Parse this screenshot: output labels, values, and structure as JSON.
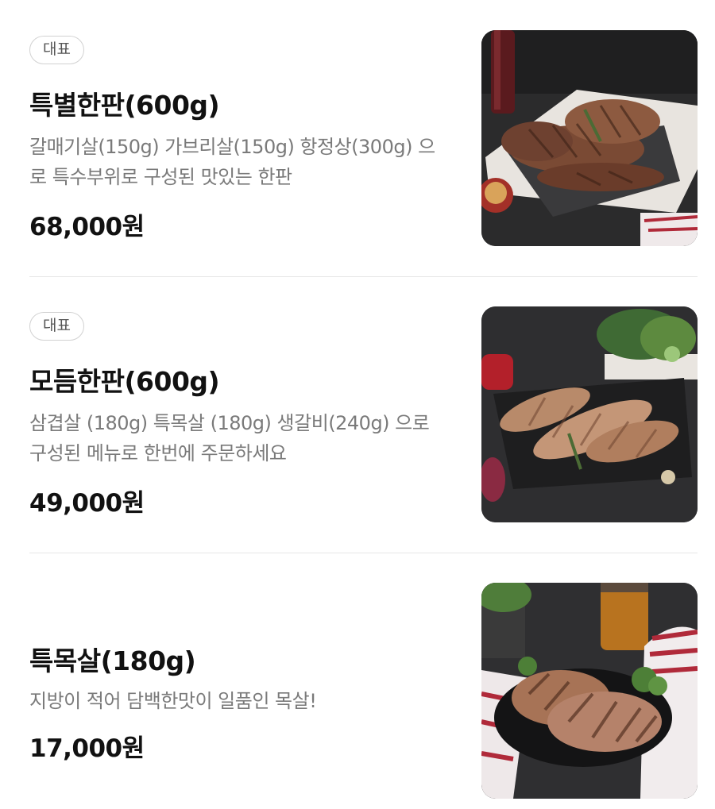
{
  "menu_items": [
    {
      "badge": "대표",
      "name": "특별한판(600g)",
      "description": "갈매기살(150g) 가브리살(150g) 항정상(300g) 으로 특수부위로 구성된 맛있는 한판",
      "price": "68,000원",
      "image_icon": "grilled-pork-platter-image"
    },
    {
      "badge": "대표",
      "name": "모듬한판(600g)",
      "description": "삼겹살 (180g) 특목살 (180g) 생갈비(240g) 으로 구성된 메뉴로 한번에 주문하세요",
      "price": "49,000원",
      "image_icon": "grilled-pork-board-image"
    },
    {
      "name": "특목살(180g)",
      "description": "지방이 적어 담백한맛이 일품인 목살!",
      "price": "17,000원",
      "image_icon": "grilled-pork-neck-image"
    }
  ],
  "colors": {
    "text_primary": "#111111",
    "text_secondary": "#7a7a7a",
    "badge_border": "#d2d2d2",
    "divider": "#e6e6e6"
  }
}
